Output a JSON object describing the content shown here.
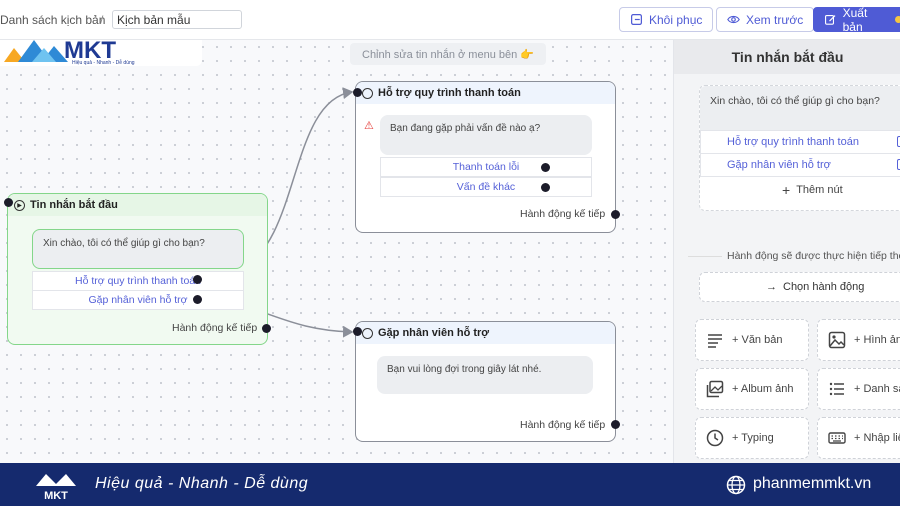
{
  "topbar": {
    "breadcrumb": "Danh sách kịch bản",
    "separator": "/",
    "scenario_name": "Kịch bản mẫu",
    "restore_label": "Khôi phục",
    "preview_label": "Xem trước",
    "export_label": "Xuất bản"
  },
  "brand": {
    "logo_text": "MKT",
    "logo_tagline": "Hiệu quả - Nhanh - Dễ dùng"
  },
  "canvas": {
    "hint": "Chỉnh sửa tin nhắn ở menu bên 👉",
    "nodes": {
      "start": {
        "title": "Tin nhắn bắt đầu",
        "message": "Xin chào, tôi có thể giúp gì cho bạn?",
        "options": [
          "Hỗ trợ quy trình thanh toán",
          "Gặp nhân viên hỗ trợ"
        ],
        "next": "Hành động kế tiếp"
      },
      "payment": {
        "title": "Hỗ trợ quy trình thanh toán",
        "message": "Bạn đang gặp phải vấn đề nào ạ?",
        "options": [
          "Thanh toán lỗi",
          "Vấn đề khác"
        ],
        "next": "Hành động kế tiếp",
        "warning_icon": "warning-icon"
      },
      "staff": {
        "title": "Gặp nhân viên hỗ trợ",
        "message": "Bạn vui lòng đợi trong giây lát nhé.",
        "next": "Hành động kế tiếp"
      }
    }
  },
  "panel": {
    "title": "Tin nhắn bắt đầu",
    "message": "Xin chào, tôi có thể giúp gì cho bạn?",
    "options": [
      "Hỗ trợ quy trình thanh toán",
      "Gặp nhân viên hỗ trợ"
    ],
    "add_button": "Thêm nút",
    "next_note": "Hành động sẽ được thực hiện tiếp theo",
    "choose_action": "Chọn hành động",
    "tiles": [
      "+ Văn bản",
      "+ Hình ảnh",
      "+ Album ảnh",
      "+ Danh sách",
      "+ Typing",
      "+ Nhập liệu"
    ]
  },
  "footer": {
    "tagline": "Hiệu quả - Nhanh - Dễ dùng",
    "website": "phanmemmkt.vn"
  },
  "colors": {
    "accent": "#4f5bd5",
    "start_node_border": "#84d68a",
    "footer_bg": "#152a6e"
  }
}
